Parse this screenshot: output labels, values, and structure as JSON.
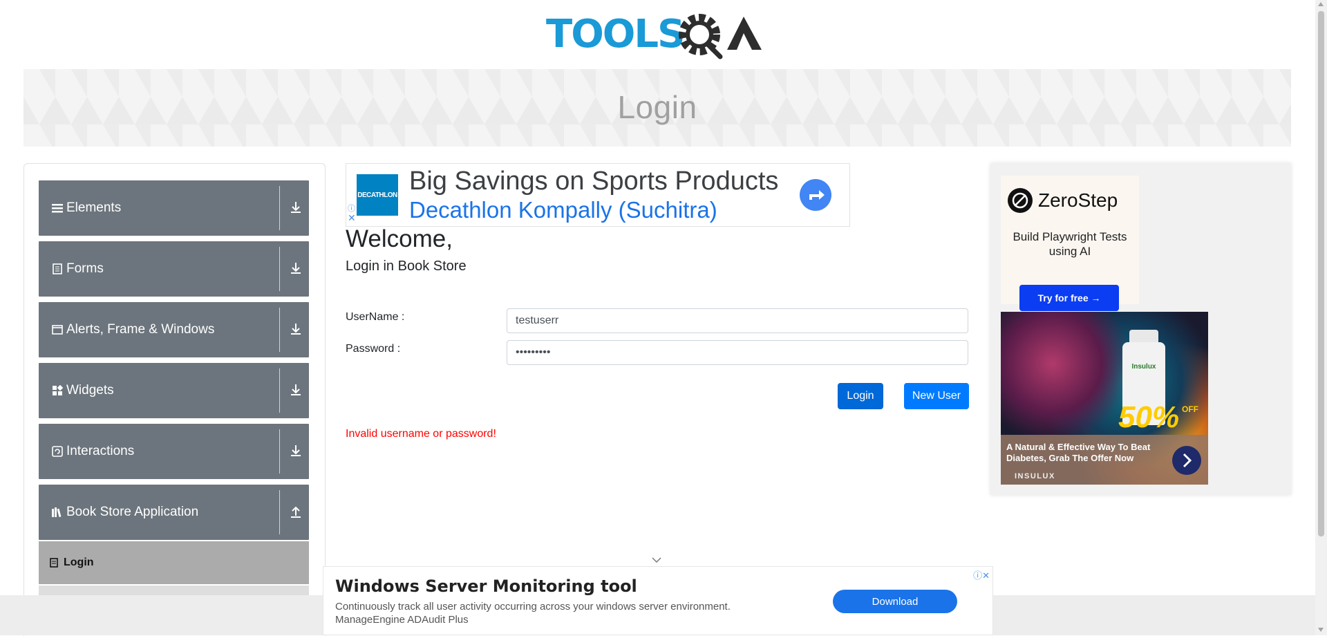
{
  "header": {
    "logo_text": "TOOLSQA",
    "page_title": "Login"
  },
  "sidebar": {
    "groups": [
      {
        "label": "Elements",
        "icon": "hamburger-icon",
        "state": "collapsed"
      },
      {
        "label": "Forms",
        "icon": "document-icon",
        "state": "collapsed"
      },
      {
        "label": "Alerts, Frame & Windows",
        "icon": "window-icon",
        "state": "collapsed"
      },
      {
        "label": "Widgets",
        "icon": "widgets-icon",
        "state": "collapsed"
      },
      {
        "label": "Interactions",
        "icon": "interactions-icon",
        "state": "collapsed"
      },
      {
        "label": "Book Store Application",
        "icon": "books-icon",
        "state": "expanded"
      }
    ],
    "active_item": {
      "label": "Login",
      "icon": "login-icon"
    }
  },
  "ad_top": {
    "brand": "DECATHLON",
    "headline": "Big Savings on Sports Products",
    "sub": "Decathlon Kompally (Suchitra)"
  },
  "main": {
    "welcome": "Welcome,",
    "subtitle": "Login in Book Store",
    "username_label": "UserName :",
    "username_value": "testuserr",
    "password_label": "Password :",
    "password_value": "•••••••••",
    "login_button": "Login",
    "new_user_button": "New User",
    "error_message": "Invalid username or password!"
  },
  "ad_right": {
    "brand": "ZeroStep",
    "tagline": "Build Playwright Tests using AI",
    "cta": "Try for free →",
    "promo_text": "A Natural & Effective Way To Beat Diabetes, Grab The Offer Now",
    "promo_brand": "INSULUX",
    "promo_badge": "50%",
    "promo_badge_suffix": "OFF",
    "bottle_label": "Insulux"
  },
  "ad_bottom": {
    "title": "Windows Server Monitoring tool",
    "description": "Continuously track all user activity occurring across your windows server environment.",
    "sponsor": "ManageEngine ADAudit Plus",
    "cta": "Download"
  },
  "colors": {
    "sidebar_group": "#6c757d",
    "active_item": "#ababab",
    "primary_button": "#007bff",
    "error": "#ff0000",
    "logo_blue": "#1a9ad6",
    "logo_dark": "#2d2d2d"
  }
}
